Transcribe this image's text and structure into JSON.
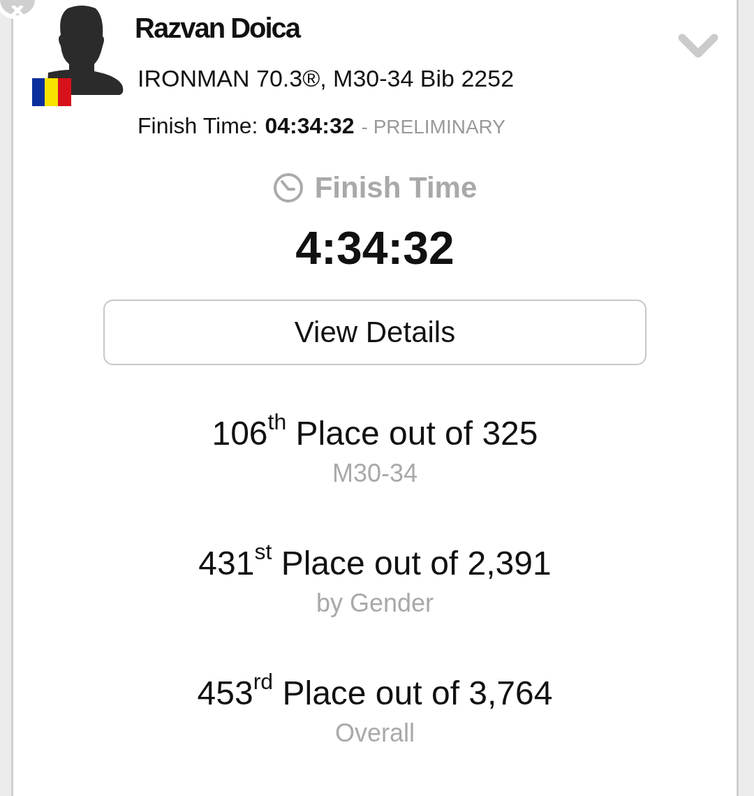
{
  "athlete": {
    "name": "Razvan Doica",
    "event": "IRONMAN 70.3®, M30-34 Bib 2252",
    "finish": {
      "label": "Finish Time:",
      "value": "04:34:32",
      "status": "- PRELIMINARY"
    }
  },
  "result": {
    "heading": "Finish Time",
    "time": "4:34:32",
    "button": "View Details"
  },
  "places": [
    {
      "place": "106$^{th}$ Place out of 325",
      "group": "M30-34"
    },
    {
      "place": "431$^{st}$ Place out of 2,391",
      "group": "by Gender"
    },
    {
      "place": "453$^{rd}$ Place out of 3,764",
      "group": "Overall"
    }
  ]
}
